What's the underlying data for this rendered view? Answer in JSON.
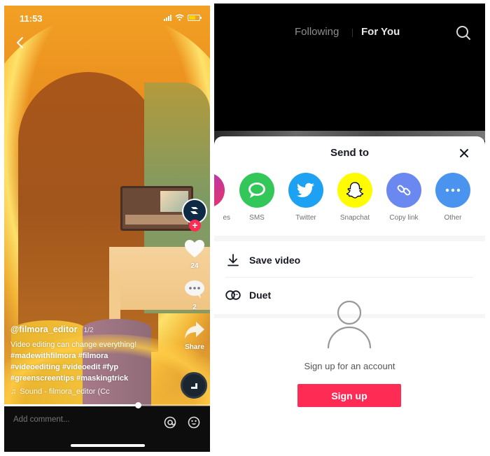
{
  "left_screen": {
    "status_bar": {
      "time": "11:53"
    },
    "back_label": "‹",
    "rail": {
      "likes_count": "24",
      "comments_count": "2",
      "share_label": "Share"
    },
    "caption": {
      "username": "@filmora_editor",
      "page_indicator": "1/2",
      "description": "Video editing can change everything!",
      "hashtags": [
        "#madewithfilmora #filmora",
        "#videoediting #videoedit #fyp",
        "#greenscreentips #maskingtrick"
      ],
      "sound": "Sound - filmora_editor (Cc"
    },
    "playback_progress_percent": 65,
    "comment_bar": {
      "placeholder": "Add comment..."
    },
    "colors": {
      "follow_badge": "#fe2c55",
      "comment_bar_bg": "#0d0d0d"
    }
  },
  "right_screen": {
    "top_tabs": {
      "following": "Following",
      "for_you": "For You",
      "active": "For You"
    },
    "share_sheet": {
      "title": "Send to",
      "share_targets": [
        {
          "label": "Messages",
          "visible_label": "es",
          "icon": "instagram-icon",
          "color": "#d62f7e"
        },
        {
          "label": "SMS",
          "icon": "sms-icon",
          "color": "#33c75a"
        },
        {
          "label": "Twitter",
          "icon": "twitter-icon",
          "color": "#1da1f2"
        },
        {
          "label": "Snapchat",
          "icon": "snapchat-icon",
          "color": "#fffc00"
        },
        {
          "label": "Copy link",
          "icon": "link-icon",
          "color": "#6a88f0"
        },
        {
          "label": "Other",
          "icon": "more-icon",
          "color": "#4a94f0"
        }
      ],
      "actions": [
        {
          "label": "Save video",
          "icon": "download-icon"
        },
        {
          "label": "Duet",
          "icon": "duet-icon"
        }
      ],
      "signup_prompt": "Sign up for an account",
      "signup_button": "Sign up"
    },
    "colors": {
      "accent": "#fe2c55"
    }
  }
}
